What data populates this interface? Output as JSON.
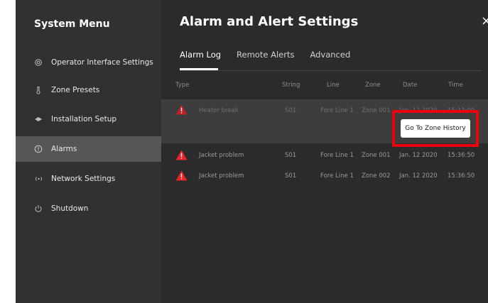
{
  "sidebar": {
    "title": "System Menu",
    "items": [
      {
        "label": "Operator Interface Settings",
        "icon": "gear-icon"
      },
      {
        "label": "Zone Presets",
        "icon": "thermometer-icon"
      },
      {
        "label": "Installation Setup",
        "icon": "cube-icon"
      },
      {
        "label": "Alarms",
        "icon": "info-circle-icon"
      },
      {
        "label": "Network Settings",
        "icon": "broadcast-icon"
      },
      {
        "label": "Shutdown",
        "icon": "power-icon"
      }
    ],
    "active_item": "Alarms"
  },
  "main": {
    "title": "Alarm and Alert Settings",
    "close_glyph": "×",
    "tabs": [
      {
        "label": "Alarm Log"
      },
      {
        "label": "Remote Alerts"
      },
      {
        "label": "Advanced"
      }
    ],
    "active_tab": "Alarm Log",
    "columns": [
      "Type",
      "String",
      "Line",
      "Zone",
      "Date",
      "Time"
    ],
    "rows": [
      {
        "type": "Heater break",
        "string": "S01",
        "line": "Fore Line 1",
        "zone": "Zone 001",
        "date": "Jan. 12 2020",
        "time": "15:33:00"
      },
      {
        "type": "Jacket problem",
        "string": "S01",
        "line": "Fore Line 1",
        "zone": "Zone 001",
        "date": "Jan. 12 2020",
        "time": "15:36:50"
      },
      {
        "type": "Jacket problem",
        "string": "S01",
        "line": "Fore Line 1",
        "zone": "Zone 002",
        "date": "Jan. 12 2020",
        "time": "15:36:50"
      }
    ],
    "action_button": "Go To Zone History"
  },
  "colors": {
    "alarm_red": "#e8232b",
    "highlight_red": "#e8000e",
    "sidebar_bg": "#313131",
    "main_bg": "#2b2b2b",
    "active_item_bg": "#565656"
  }
}
